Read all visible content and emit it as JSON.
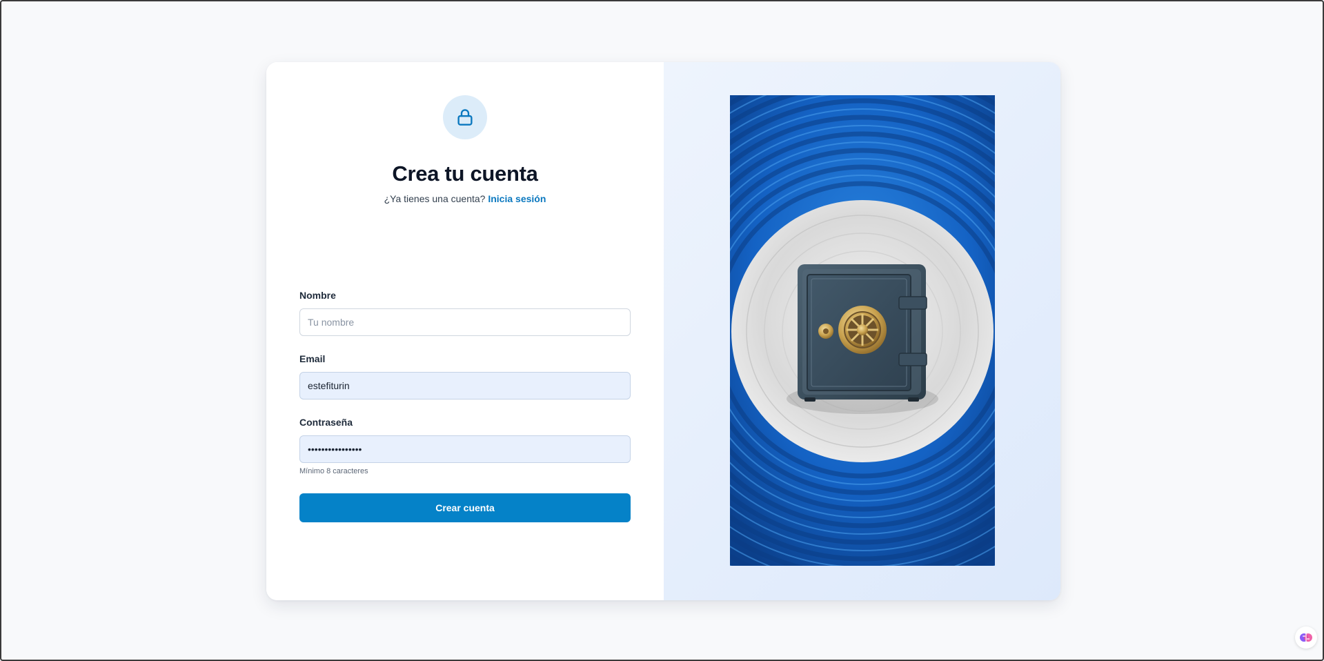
{
  "header": {
    "title": "Crea tu cuenta",
    "subtitle_text": "¿Ya tienes una cuenta?",
    "login_link": "Inicia sesión"
  },
  "form": {
    "name": {
      "label": "Nombre",
      "placeholder": "Tu nombre",
      "value": ""
    },
    "email": {
      "label": "Email",
      "value": "estefiturin"
    },
    "password": {
      "label": "Contraseña",
      "value": "••••••••••••••••",
      "helper": "Mínimo 8 caracteres"
    },
    "submit_label": "Crear cuenta"
  },
  "icons": {
    "header_icon": "lock-icon",
    "illustration": "safe-illustration",
    "corner": "brain-logo-icon"
  },
  "colors": {
    "accent": "#0582c8",
    "link": "#0b78bf",
    "icon_bg": "#dcecf9",
    "filled_input_bg": "#e8f0fd"
  }
}
